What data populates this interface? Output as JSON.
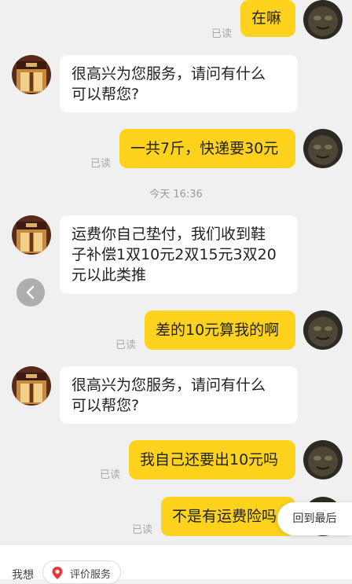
{
  "messages": [
    {
      "side": "me",
      "text": "在嘛",
      "read": "已读"
    },
    {
      "side": "shop",
      "text": "很高兴为您服务，请问有什么\n可以帮您?"
    },
    {
      "side": "me",
      "text": "一共7斤，快递要30元",
      "read": "已读"
    },
    {
      "side": "shop",
      "text": "运费你自己垫付，我们收到鞋\n子补偿1双10元2双15元3双20\n元以此类推"
    },
    {
      "side": "me",
      "text": "差的10元算我的啊",
      "read": "已读"
    },
    {
      "side": "shop",
      "text": "很高兴为您服务，请问有什么\n可以帮您?"
    },
    {
      "side": "me",
      "text": "我自己还要出10元吗",
      "read": "已读"
    },
    {
      "side": "me",
      "text": "不是有运费险吗",
      "read": "已读"
    }
  ],
  "timestamp": "今天 16:36",
  "back_to_bottom_label": "回到最后",
  "bottom_bar": {
    "want_label": "我想",
    "review_chip_label": "评价服务"
  },
  "colors": {
    "my_bubble": "#ffd21e",
    "shop_bubble": "#ffffff",
    "background": "#f0f0f0",
    "chip_icon": "#e8363a"
  }
}
